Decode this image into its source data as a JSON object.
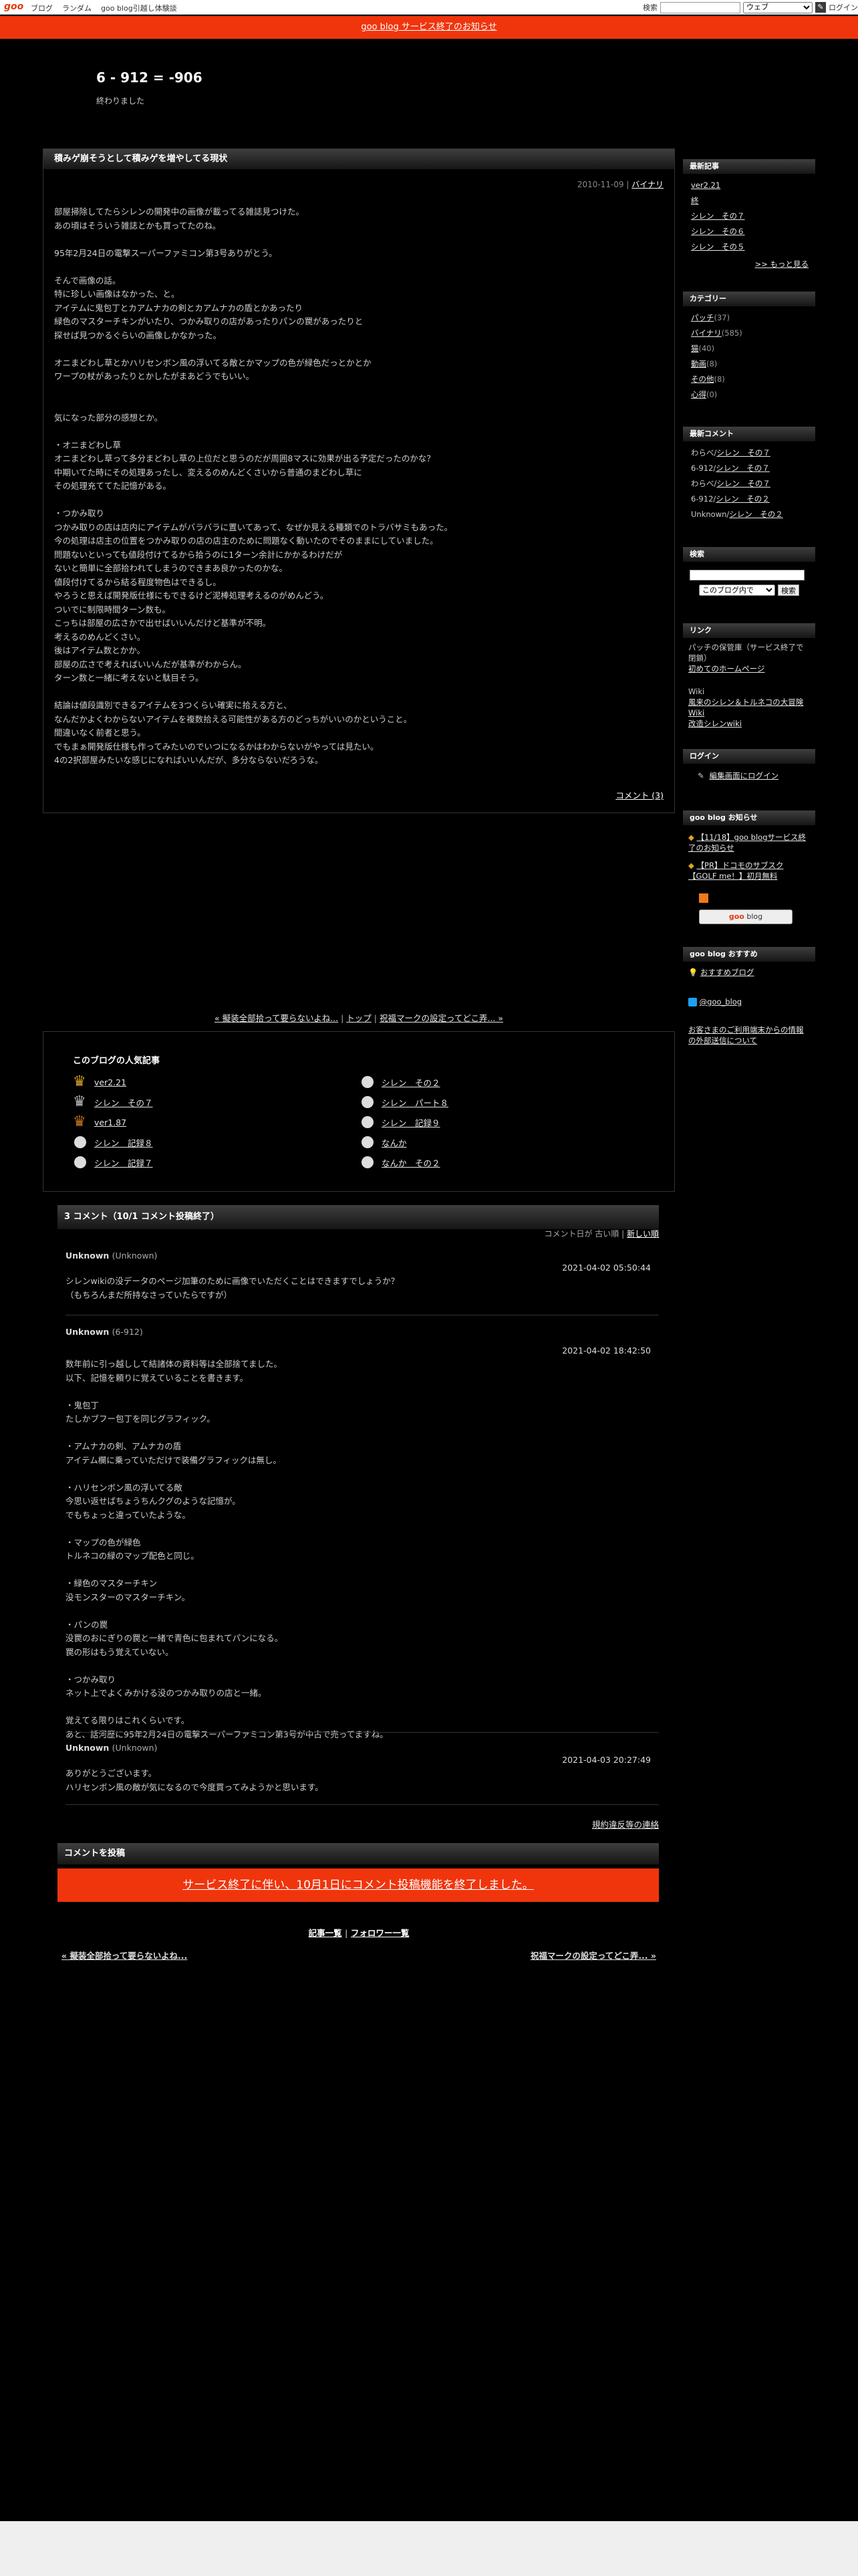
{
  "topbar": {
    "logo": "goo",
    "nav": [
      "ブログ",
      "ランダム",
      "goo blog引越し体験談"
    ],
    "search_label": "検索",
    "search_scope": "ウェブ",
    "login": "ログイン"
  },
  "notice": "goo blog サービス終了のお知らせ",
  "blog": {
    "title": "6 - 912 = -906",
    "subtitle": "終わりました"
  },
  "article": {
    "title": "積みゲ崩そうとして積みゲを増やしてる現状",
    "date": "2010-11-09",
    "category": "バイナリ",
    "lines": [
      "部屋掃除してたらシレンの開発中の画像が載ってる雑誌見つけた。",
      "あの頃はそういう雑誌とかも買ってたのね。",
      "",
      "95年2月24日の電撃スーパーファミコン第3号ありがとう。",
      "",
      "そんで画像の話。",
      "特に珍しい画像はなかった、と。",
      "アイテムに鬼包丁とカアムナカの剣とカアムナカの盾とかあったり",
      "緑色のマスターチキンがいたり、つかみ取りの店があったりパンの罠があったりと",
      "探せば見つかるぐらいの画像しかなかった。",
      "",
      "オニまどわし草とかハリセンボン風の浮いてる敵とかマップの色が緑色だっとかとか",
      "ワープの杖があったりとかしたがまあどうでもいい。",
      "",
      "",
      "気になった部分の感想とか。",
      "",
      "・オニまどわし草",
      "オニまどわし草って多分まどわし草の上位だと思うのだが周囲8マスに効果が出る予定だったのかな？",
      "中期いてた時にその処理あったし、変えるのめんどくさいから普通のまどわし草に",
      "その処理充ててた記憶がある。",
      "",
      "・つかみ取り",
      "つかみ取りの店は店内にアイテムがバラバラに置いてあって、なぜか見える種類でのトラバサミもあった。",
      "今の処理は店主の位置をつかみ取りの店の店主のために問題なく動いたのでそのままにしていました。",
      "問題ないといっても値段付けてるから拾うのに1ターン余計にかかるわけだが",
      "ないと簡単に全部拾われてしまうのできまあ良かったのかな。",
      "値段付けてるから結る程度物色はできるし。",
      "やろうと思えば開発版仕様にもできるけど泥棒処理考えるのがめんどう。",
      "ついでに制限時間ターン数も。",
      "こっちは部屋の広さかで出せばいいんだけど基準が不明。",
      "考えるのめんどくさい。",
      "後はアイテム数とかか。",
      "部屋の広さで考えればいいんだが基準がわからん。",
      "ターン数と一緒に考えないと駄目そう。",
      "",
      "結論は値段識別できるアイテムを3つくらい確実に拾える方と、",
      "なんだかよくわからないアイテムを複数拾える可能性がある方のどっちがいいのかということ。",
      "間違いなく前者と思う。",
      "でもまぁ開発版仕様も作ってみたいのでいつになるかはわからないがやっては見たい。",
      "4の2択部屋みたいな感じになればいいんだが、多分ならないだろうな。"
    ],
    "comment_link": "コメント (3)"
  },
  "postnav": {
    "prev": "« 擬装全部拾って要らないよね...",
    "top": "トップ",
    "next": "祝福マークの設定ってどこ弄... »"
  },
  "popular": {
    "heading": "このブログの人気記事",
    "items": [
      {
        "label": "ver2.21",
        "mark": "gold"
      },
      {
        "label": "シレン　その２",
        "mark": "dot"
      },
      {
        "label": "シレン　その７",
        "mark": "silver"
      },
      {
        "label": "シレン　パート８",
        "mark": "dot"
      },
      {
        "label": "ver1.87",
        "mark": "bronze"
      },
      {
        "label": "シレン　記録９",
        "mark": "dot"
      },
      {
        "label": "シレン　記録８",
        "mark": "dot"
      },
      {
        "label": "なんか",
        "mark": "dot"
      },
      {
        "label": "シレン　記録７",
        "mark": "dot"
      },
      {
        "label": "なんか　その２",
        "mark": "dot"
      }
    ]
  },
  "comments": {
    "heading": "3 コメント（10/1 コメント投稿終了）",
    "sort_label": "コメント日が",
    "sort_old": "古い順",
    "sort_new": "新しい順",
    "items": [
      {
        "author": "Unknown",
        "author_sub": "(Unknown)",
        "date": "2021-04-02 05:50:44",
        "lines": [
          "シレンwikiの没データのページ加筆のために画像でいただくことはできますでしょうか？",
          "（もちろんまだ所持なさっていたらですが）"
        ]
      },
      {
        "author": "Unknown",
        "author_sub": "(6-912)",
        "date": "2021-04-02 18:42:50",
        "lines": [
          "数年前に引っ越しして結諸体の資料等は全部捨てました。",
          "以下、記憶を頼りに覚えていることを書きます。",
          "",
          "・鬼包丁",
          "たしかブフー包丁を同じグラフィック。",
          "",
          "・アムナカの剣、アムナカの盾",
          "アイテム欄に乗っていただけで装備グラフィックは無し。",
          "",
          "・ハリセンボン風の浮いてる敵",
          "今思い返せばちょうちんクグのような記憶が。",
          "でもちょっと違っていたような。",
          "",
          "・マップの色が緑色",
          "トルネコの緑のマップ配色と同じ。",
          "",
          "・緑色のマスターチキン",
          "没モンスターのマスターチキン。",
          "",
          "・パンの罠",
          "没罠のおにぎりの罠と一緒で青色に包まれてパンになる。",
          "罠の形はもう覚えていない。",
          "",
          "・つかみ取り",
          "ネット上でよくみかける没のつかみ取りの店と一緒。",
          "",
          "覚えてる限りはこれくらいです。",
          "あと、話河歴に95年2月24日の電撃スーパーファミコン第3号が中古で売ってますね。"
        ]
      },
      {
        "author": "Unknown",
        "author_sub": "(Unknown)",
        "date": "2021-04-03 20:27:49",
        "lines": [
          "ありがとうございます。",
          "ハリセンボン風の敵が気になるので今度買ってみようかと思います。"
        ]
      }
    ],
    "terms": "規約違反等の連絡",
    "post_heading": "コメントを投稿",
    "closed_notice": "サービス終了に伴い、10月1日にコメント投稿機能を終了しました。"
  },
  "footer": {
    "list_link": "記事一覧",
    "follower_link": "フォロワー一覧",
    "prev": "« 擬装全部拾って要らないよね...",
    "next": "祝福マークの設定ってどこ弄... »"
  },
  "sidebar": {
    "recent": {
      "heading": "最新記事",
      "items": [
        "ver2.21",
        "終",
        "シレン　その７",
        "シレン　その６",
        "シレン　その５"
      ],
      "more": ">> もっと見る"
    },
    "categories": {
      "heading": "カテゴリー",
      "items": [
        {
          "name": "パッチ",
          "count": "(37)"
        },
        {
          "name": "バイナリ",
          "count": "(585)"
        },
        {
          "name": "猫",
          "count": "(40)"
        },
        {
          "name": "動画",
          "count": "(8)"
        },
        {
          "name": "その他",
          "count": "(8)"
        },
        {
          "name": "心得",
          "count": "(0)"
        }
      ]
    },
    "recent_comments": {
      "heading": "最新コメント",
      "items": [
        {
          "who": "わらべ/",
          "link": "シレン　その７"
        },
        {
          "who": "6-912/",
          "link": "シレン　その７"
        },
        {
          "who": "わらべ/",
          "link": "シレン　その７"
        },
        {
          "who": "6-912/",
          "link": "シレン　その２"
        },
        {
          "who": "Unknown/",
          "link": "シレン　その２"
        }
      ]
    },
    "search": {
      "heading": "検索",
      "scope": "このブログ内で",
      "button": "検索"
    },
    "links": {
      "heading": "リンク",
      "group1_text": "パッチの保管庫（サービス終了で閉鎖）",
      "group1_link": "初めてのホームページ",
      "group2_text": "Wiki",
      "group2_link1": "風来のシレン＆トルネコの大冒険 Wiki",
      "group2_link2": "改造シレンwiki"
    },
    "login": {
      "heading": "ログイン",
      "link": "編集画面にログイン"
    },
    "goo_notice": {
      "heading": "goo blog お知らせ",
      "items": [
        "【11/18】goo blogサービス終了のお知らせ",
        "【PR】ドコモのサブスク【GOLF me！】初月無料"
      ],
      "badge_goo": "goo",
      "badge_blog": " blog"
    },
    "recommend": {
      "heading": "goo blog おすすめ",
      "link": "おすすめブログ",
      "twitter": "@goo_blog",
      "external": "お客さまのご利用端末からの情報の外部送信について"
    }
  }
}
